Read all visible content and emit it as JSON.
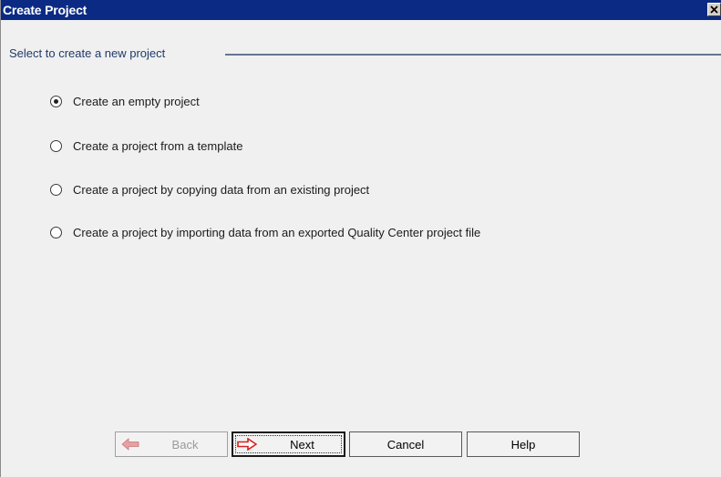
{
  "window": {
    "title": "Create Project"
  },
  "group": {
    "header": "Select to create a new project"
  },
  "options": [
    {
      "label": "Create an empty project",
      "checked": true
    },
    {
      "label": "Create a project from a template",
      "checked": false
    },
    {
      "label": "Create a project by copying data from an existing project",
      "checked": false
    },
    {
      "label": "Create a project by importing data from an exported Quality Center project file",
      "checked": false
    }
  ],
  "buttons": {
    "back": {
      "label": "Back",
      "icon": "arrow-left-icon",
      "enabled": false
    },
    "next": {
      "label": "Next",
      "icon": "arrow-right-icon",
      "enabled": true
    },
    "cancel": {
      "label": "Cancel"
    },
    "help": {
      "label": "Help"
    }
  },
  "colors": {
    "titlebar": "#0a2a84",
    "group_header_text": "#1f3a6b",
    "arrow_enabled": "#d62020",
    "arrow_disabled": "#e8a0a0"
  }
}
